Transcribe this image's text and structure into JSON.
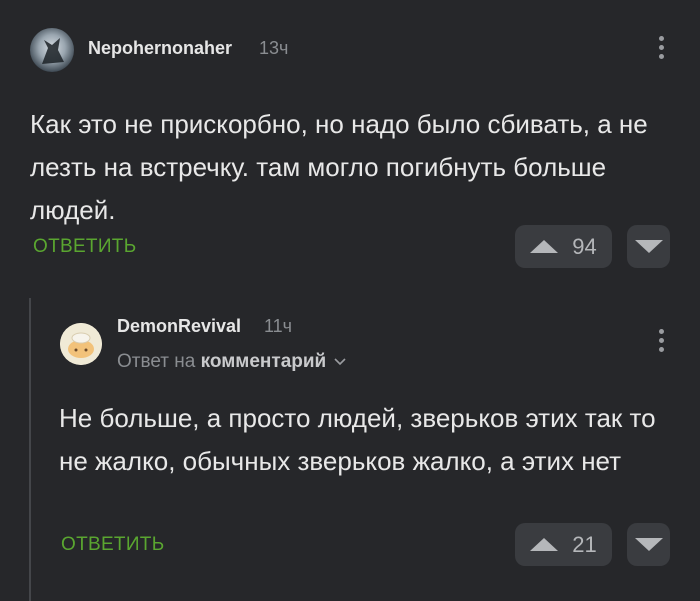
{
  "comments": [
    {
      "username": "Nepohernonaher",
      "time": "13ч",
      "text": "Как это не прискорбно, но надо было сбивать, а не лезть на встречку. там могло погибнуть больше людей.",
      "reply_label": "ОТВЕТИТЬ",
      "votes": "94"
    },
    {
      "username": "DemonRevival",
      "time": "11ч",
      "reply_to_prefix": "Ответ на",
      "reply_to_target": "комментарий",
      "text": "Не больше, а просто людей, зверьков этих так то не жалко, обычных зверьков жалко, а этих нет",
      "reply_label": "ОТВЕТИТЬ",
      "votes": "21"
    }
  ],
  "colors": {
    "background": "#26272a",
    "reply_link": "#5aa630",
    "vote_box": "#3a3c40"
  },
  "icons": [
    "avatar",
    "more-vertical-icon",
    "upvote-icon",
    "downvote-icon",
    "chevron-down-icon"
  ]
}
